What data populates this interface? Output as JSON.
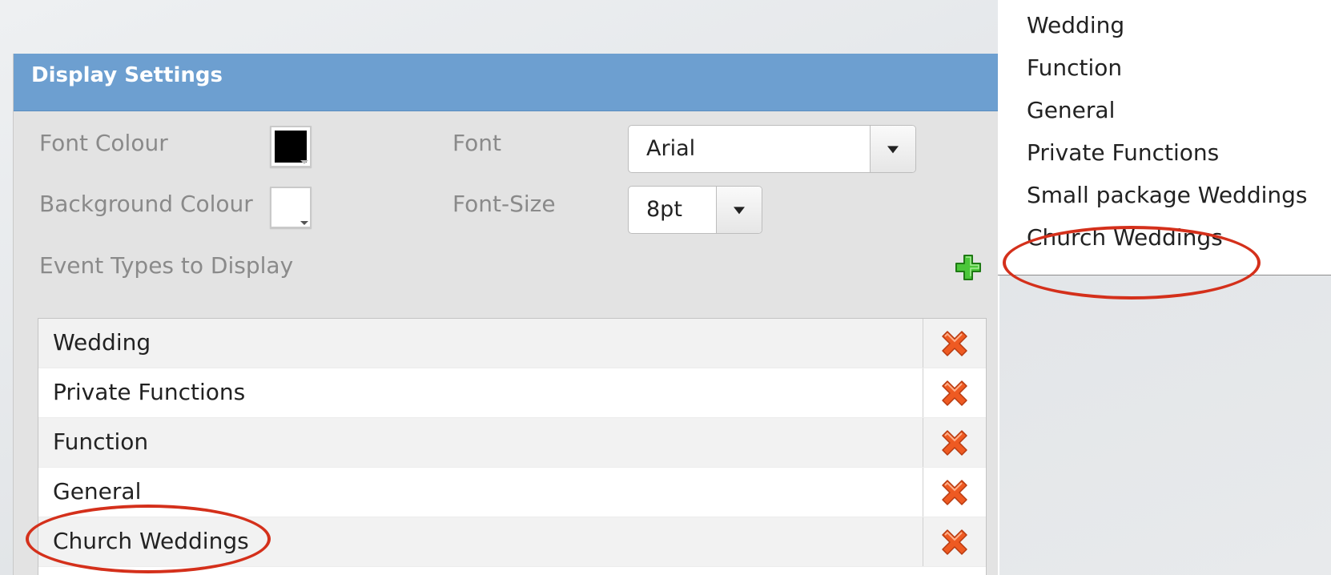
{
  "panel": {
    "title": "Display Settings",
    "font_colour_label": "Font Colour",
    "background_colour_label": "Background Colour",
    "font_label": "Font",
    "font_size_label": "Font-Size",
    "event_types_label": "Event Types to Display",
    "font_value": "Arial",
    "font_size_value": "8pt",
    "font_colour": "#000000",
    "background_colour": "#ffffff"
  },
  "event_list": [
    "Wedding",
    "Private Functions",
    "Function",
    "General",
    "Church Weddings"
  ],
  "dropdown_options": [
    "Wedding",
    "Function",
    "General",
    "Private Functions",
    "Small package Weddings",
    "Church Weddings"
  ],
  "icons": {
    "add": "plus-icon",
    "delete": "delete-x-icon",
    "dropdown": "chevron-down-icon"
  },
  "colors": {
    "header": "#6d9fd0",
    "annotation": "#d4301b",
    "delete": "#e8521a",
    "add": "#33aa22"
  }
}
